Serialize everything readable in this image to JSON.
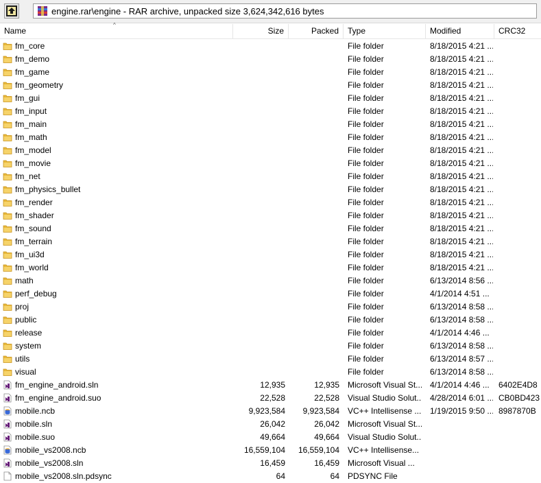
{
  "toolbar": {
    "path_text": "engine.rar\\engine - RAR archive, unpacked size 3,624,342,616 bytes"
  },
  "columns": {
    "name": "Name",
    "size": "Size",
    "packed": "Packed",
    "type": "Type",
    "modified": "Modified",
    "crc": "CRC32"
  },
  "colors": {
    "folder": "#e8b83a",
    "folder_dark": "#c99520",
    "sln_purple": "#68217a"
  },
  "rows": [
    {
      "name": "fm_core",
      "size": "",
      "packed": "",
      "type": "File folder",
      "modified": "8/18/2015 4:21 ...",
      "crc": "",
      "icon": "folder-icon"
    },
    {
      "name": "fm_demo",
      "size": "",
      "packed": "",
      "type": "File folder",
      "modified": "8/18/2015 4:21 ...",
      "crc": "",
      "icon": "folder-icon"
    },
    {
      "name": "fm_game",
      "size": "",
      "packed": "",
      "type": "File folder",
      "modified": "8/18/2015 4:21 ...",
      "crc": "",
      "icon": "folder-icon"
    },
    {
      "name": "fm_geometry",
      "size": "",
      "packed": "",
      "type": "File folder",
      "modified": "8/18/2015 4:21 ...",
      "crc": "",
      "icon": "folder-icon"
    },
    {
      "name": "fm_gui",
      "size": "",
      "packed": "",
      "type": "File folder",
      "modified": "8/18/2015 4:21 ...",
      "crc": "",
      "icon": "folder-icon"
    },
    {
      "name": "fm_input",
      "size": "",
      "packed": "",
      "type": "File folder",
      "modified": "8/18/2015 4:21 ...",
      "crc": "",
      "icon": "folder-icon"
    },
    {
      "name": "fm_main",
      "size": "",
      "packed": "",
      "type": "File folder",
      "modified": "8/18/2015 4:21 ...",
      "crc": "",
      "icon": "folder-icon"
    },
    {
      "name": "fm_math",
      "size": "",
      "packed": "",
      "type": "File folder",
      "modified": "8/18/2015 4:21 ...",
      "crc": "",
      "icon": "folder-icon"
    },
    {
      "name": "fm_model",
      "size": "",
      "packed": "",
      "type": "File folder",
      "modified": "8/18/2015 4:21 ...",
      "crc": "",
      "icon": "folder-icon"
    },
    {
      "name": "fm_movie",
      "size": "",
      "packed": "",
      "type": "File folder",
      "modified": "8/18/2015 4:21 ...",
      "crc": "",
      "icon": "folder-icon"
    },
    {
      "name": "fm_net",
      "size": "",
      "packed": "",
      "type": "File folder",
      "modified": "8/18/2015 4:21 ...",
      "crc": "",
      "icon": "folder-icon"
    },
    {
      "name": "fm_physics_bullet",
      "size": "",
      "packed": "",
      "type": "File folder",
      "modified": "8/18/2015 4:21 ...",
      "crc": "",
      "icon": "folder-icon"
    },
    {
      "name": "fm_render",
      "size": "",
      "packed": "",
      "type": "File folder",
      "modified": "8/18/2015 4:21 ...",
      "crc": "",
      "icon": "folder-icon"
    },
    {
      "name": "fm_shader",
      "size": "",
      "packed": "",
      "type": "File folder",
      "modified": "8/18/2015 4:21 ...",
      "crc": "",
      "icon": "folder-icon"
    },
    {
      "name": "fm_sound",
      "size": "",
      "packed": "",
      "type": "File folder",
      "modified": "8/18/2015 4:21 ...",
      "crc": "",
      "icon": "folder-icon"
    },
    {
      "name": "fm_terrain",
      "size": "",
      "packed": "",
      "type": "File folder",
      "modified": "8/18/2015 4:21 ...",
      "crc": "",
      "icon": "folder-icon"
    },
    {
      "name": "fm_ui3d",
      "size": "",
      "packed": "",
      "type": "File folder",
      "modified": "8/18/2015 4:21 ...",
      "crc": "",
      "icon": "folder-icon"
    },
    {
      "name": "fm_world",
      "size": "",
      "packed": "",
      "type": "File folder",
      "modified": "8/18/2015 4:21 ...",
      "crc": "",
      "icon": "folder-icon"
    },
    {
      "name": "math",
      "size": "",
      "packed": "",
      "type": "File folder",
      "modified": "6/13/2014 8:56 ...",
      "crc": "",
      "icon": "folder-icon"
    },
    {
      "name": "perf_debug",
      "size": "",
      "packed": "",
      "type": "File folder",
      "modified": "4/1/2014 4:51 ...",
      "crc": "",
      "icon": "folder-icon"
    },
    {
      "name": "proj",
      "size": "",
      "packed": "",
      "type": "File folder",
      "modified": "6/13/2014 8:58 ...",
      "crc": "",
      "icon": "folder-icon"
    },
    {
      "name": "public",
      "size": "",
      "packed": "",
      "type": "File folder",
      "modified": "6/13/2014 8:58 ...",
      "crc": "",
      "icon": "folder-icon"
    },
    {
      "name": "release",
      "size": "",
      "packed": "",
      "type": "File folder",
      "modified": "4/1/2014 4:46 ...",
      "crc": "",
      "icon": "folder-icon"
    },
    {
      "name": "system",
      "size": "",
      "packed": "",
      "type": "File folder",
      "modified": "6/13/2014 8:58 ...",
      "crc": "",
      "icon": "folder-icon"
    },
    {
      "name": "utils",
      "size": "",
      "packed": "",
      "type": "File folder",
      "modified": "6/13/2014 8:57 ...",
      "crc": "",
      "icon": "folder-icon"
    },
    {
      "name": "visual",
      "size": "",
      "packed": "",
      "type": "File folder",
      "modified": "6/13/2014 8:58 ...",
      "crc": "",
      "icon": "folder-icon"
    },
    {
      "name": "fm_engine_android.sln",
      "size": "12,935",
      "packed": "12,935",
      "type": "Microsoft Visual St...",
      "modified": "4/1/2014 4:46 ...",
      "crc": "6402E4D8",
      "icon": "visual-studio-solution-icon"
    },
    {
      "name": "fm_engine_android.suo",
      "size": "22,528",
      "packed": "22,528",
      "type": "Visual Studio Solut...",
      "modified": "4/28/2014 6:01 ...",
      "crc": "CB0BD423",
      "icon": "visual-studio-suo-icon"
    },
    {
      "name": "mobile.ncb",
      "size": "9,923,584",
      "packed": "9,923,584",
      "type": "VC++ Intellisense ...",
      "modified": "1/19/2015 9:50 ...",
      "crc": "8987870B",
      "icon": "intellisense-db-icon"
    },
    {
      "name": "mobile.sln",
      "size": "26,042",
      "packed": "26,042",
      "type": "Microsoft Visual St...",
      "modified": "",
      "crc": "",
      "icon": "visual-studio-solution-icon"
    },
    {
      "name": "mobile.suo",
      "size": "49,664",
      "packed": "49,664",
      "type": "Visual Studio Solut...",
      "modified": "",
      "crc": "",
      "icon": "visual-studio-suo-icon"
    },
    {
      "name": "mobile_vs2008.ncb",
      "size": "16,559,104",
      "packed": "16,559,104",
      "type": "VC++ Intellisense...",
      "modified": "",
      "crc": "",
      "icon": "intellisense-db-icon"
    },
    {
      "name": "mobile_vs2008.sln",
      "size": "16,459",
      "packed": "16,459",
      "type": "Microsoft Visual ...",
      "modified": "",
      "crc": "",
      "icon": "visual-studio-solution-icon"
    },
    {
      "name": "mobile_vs2008.sln.pdsync",
      "size": "64",
      "packed": "64",
      "type": "PDSYNC File",
      "modified": "",
      "crc": "",
      "icon": "generic-file-icon"
    }
  ]
}
